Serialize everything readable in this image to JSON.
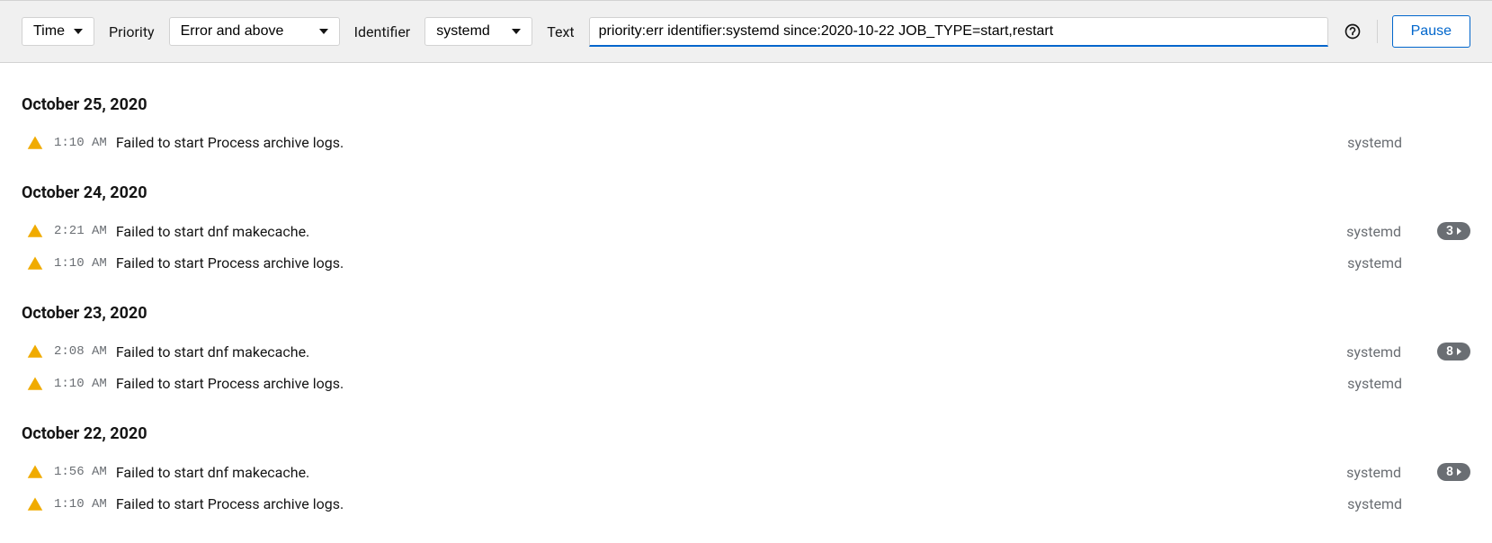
{
  "toolbar": {
    "time_label": "Time",
    "priority_label": "Priority",
    "priority_value": "Error and above",
    "identifier_label": "Identifier",
    "identifier_value": "systemd",
    "text_label": "Text",
    "search_value": "priority:err identifier:systemd since:2020-10-22 JOB_TYPE=start,restart ",
    "pause_label": "Pause"
  },
  "log_groups": [
    {
      "date": "October 25, 2020",
      "entries": [
        {
          "level": "warn",
          "time": "1:10 AM",
          "message": "Failed to start Process archive logs.",
          "source": "systemd",
          "count": null
        }
      ]
    },
    {
      "date": "October 24, 2020",
      "entries": [
        {
          "level": "warn",
          "time": "2:21 AM",
          "message": "Failed to start dnf makecache.",
          "source": "systemd",
          "count": 3
        },
        {
          "level": "warn",
          "time": "1:10 AM",
          "message": "Failed to start Process archive logs.",
          "source": "systemd",
          "count": null
        }
      ]
    },
    {
      "date": "October 23, 2020",
      "entries": [
        {
          "level": "warn",
          "time": "2:08 AM",
          "message": "Failed to start dnf makecache.",
          "source": "systemd",
          "count": 8
        },
        {
          "level": "warn",
          "time": "1:10 AM",
          "message": "Failed to start Process archive logs.",
          "source": "systemd",
          "count": null
        }
      ]
    },
    {
      "date": "October 22, 2020",
      "entries": [
        {
          "level": "warn",
          "time": "1:56 AM",
          "message": "Failed to start dnf makecache.",
          "source": "systemd",
          "count": 8
        },
        {
          "level": "warn",
          "time": "1:10 AM",
          "message": "Failed to start Process archive logs.",
          "source": "systemd",
          "count": null
        }
      ]
    }
  ]
}
